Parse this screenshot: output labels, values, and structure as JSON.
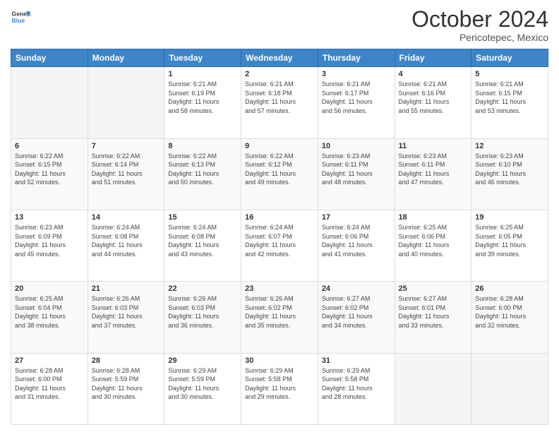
{
  "header": {
    "logo": {
      "line1": "General",
      "line2": "Blue"
    },
    "title": "October 2024",
    "subtitle": "Pericotepec, Mexico"
  },
  "days_of_week": [
    "Sunday",
    "Monday",
    "Tuesday",
    "Wednesday",
    "Thursday",
    "Friday",
    "Saturday"
  ],
  "weeks": [
    [
      {
        "day": "",
        "info": ""
      },
      {
        "day": "",
        "info": ""
      },
      {
        "day": "1",
        "sunrise": "6:21 AM",
        "sunset": "6:19 PM",
        "daylight": "11 hours and 58 minutes."
      },
      {
        "day": "2",
        "sunrise": "6:21 AM",
        "sunset": "6:18 PM",
        "daylight": "11 hours and 57 minutes."
      },
      {
        "day": "3",
        "sunrise": "6:21 AM",
        "sunset": "6:17 PM",
        "daylight": "11 hours and 56 minutes."
      },
      {
        "day": "4",
        "sunrise": "6:21 AM",
        "sunset": "6:16 PM",
        "daylight": "11 hours and 55 minutes."
      },
      {
        "day": "5",
        "sunrise": "6:21 AM",
        "sunset": "6:15 PM",
        "daylight": "11 hours and 53 minutes."
      }
    ],
    [
      {
        "day": "6",
        "sunrise": "6:22 AM",
        "sunset": "6:15 PM",
        "daylight": "11 hours and 52 minutes."
      },
      {
        "day": "7",
        "sunrise": "6:22 AM",
        "sunset": "6:14 PM",
        "daylight": "11 hours and 51 minutes."
      },
      {
        "day": "8",
        "sunrise": "6:22 AM",
        "sunset": "6:13 PM",
        "daylight": "11 hours and 50 minutes."
      },
      {
        "day": "9",
        "sunrise": "6:22 AM",
        "sunset": "6:12 PM",
        "daylight": "11 hours and 49 minutes."
      },
      {
        "day": "10",
        "sunrise": "6:23 AM",
        "sunset": "6:11 PM",
        "daylight": "11 hours and 48 minutes."
      },
      {
        "day": "11",
        "sunrise": "6:23 AM",
        "sunset": "6:11 PM",
        "daylight": "11 hours and 47 minutes."
      },
      {
        "day": "12",
        "sunrise": "6:23 AM",
        "sunset": "6:10 PM",
        "daylight": "11 hours and 46 minutes."
      }
    ],
    [
      {
        "day": "13",
        "sunrise": "6:23 AM",
        "sunset": "6:09 PM",
        "daylight": "11 hours and 45 minutes."
      },
      {
        "day": "14",
        "sunrise": "6:24 AM",
        "sunset": "6:08 PM",
        "daylight": "11 hours and 44 minutes."
      },
      {
        "day": "15",
        "sunrise": "6:24 AM",
        "sunset": "6:08 PM",
        "daylight": "11 hours and 43 minutes."
      },
      {
        "day": "16",
        "sunrise": "6:24 AM",
        "sunset": "6:07 PM",
        "daylight": "11 hours and 42 minutes."
      },
      {
        "day": "17",
        "sunrise": "6:24 AM",
        "sunset": "6:06 PM",
        "daylight": "11 hours and 41 minutes."
      },
      {
        "day": "18",
        "sunrise": "6:25 AM",
        "sunset": "6:06 PM",
        "daylight": "11 hours and 40 minutes."
      },
      {
        "day": "19",
        "sunrise": "6:25 AM",
        "sunset": "6:05 PM",
        "daylight": "11 hours and 39 minutes."
      }
    ],
    [
      {
        "day": "20",
        "sunrise": "6:25 AM",
        "sunset": "6:04 PM",
        "daylight": "11 hours and 38 minutes."
      },
      {
        "day": "21",
        "sunrise": "6:26 AM",
        "sunset": "6:03 PM",
        "daylight": "11 hours and 37 minutes."
      },
      {
        "day": "22",
        "sunrise": "6:26 AM",
        "sunset": "6:03 PM",
        "daylight": "11 hours and 36 minutes."
      },
      {
        "day": "23",
        "sunrise": "6:26 AM",
        "sunset": "6:02 PM",
        "daylight": "11 hours and 35 minutes."
      },
      {
        "day": "24",
        "sunrise": "6:27 AM",
        "sunset": "6:02 PM",
        "daylight": "11 hours and 34 minutes."
      },
      {
        "day": "25",
        "sunrise": "6:27 AM",
        "sunset": "6:01 PM",
        "daylight": "11 hours and 33 minutes."
      },
      {
        "day": "26",
        "sunrise": "6:28 AM",
        "sunset": "6:00 PM",
        "daylight": "11 hours and 32 minutes."
      }
    ],
    [
      {
        "day": "27",
        "sunrise": "6:28 AM",
        "sunset": "6:00 PM",
        "daylight": "11 hours and 31 minutes."
      },
      {
        "day": "28",
        "sunrise": "6:28 AM",
        "sunset": "5:59 PM",
        "daylight": "11 hours and 30 minutes."
      },
      {
        "day": "29",
        "sunrise": "6:29 AM",
        "sunset": "5:59 PM",
        "daylight": "11 hours and 30 minutes."
      },
      {
        "day": "30",
        "sunrise": "6:29 AM",
        "sunset": "5:58 PM",
        "daylight": "11 hours and 29 minutes."
      },
      {
        "day": "31",
        "sunrise": "6:29 AM",
        "sunset": "5:58 PM",
        "daylight": "11 hours and 28 minutes."
      },
      {
        "day": "",
        "info": ""
      },
      {
        "day": "",
        "info": ""
      }
    ]
  ],
  "labels": {
    "sunrise": "Sunrise:",
    "sunset": "Sunset:",
    "daylight": "Daylight:"
  }
}
